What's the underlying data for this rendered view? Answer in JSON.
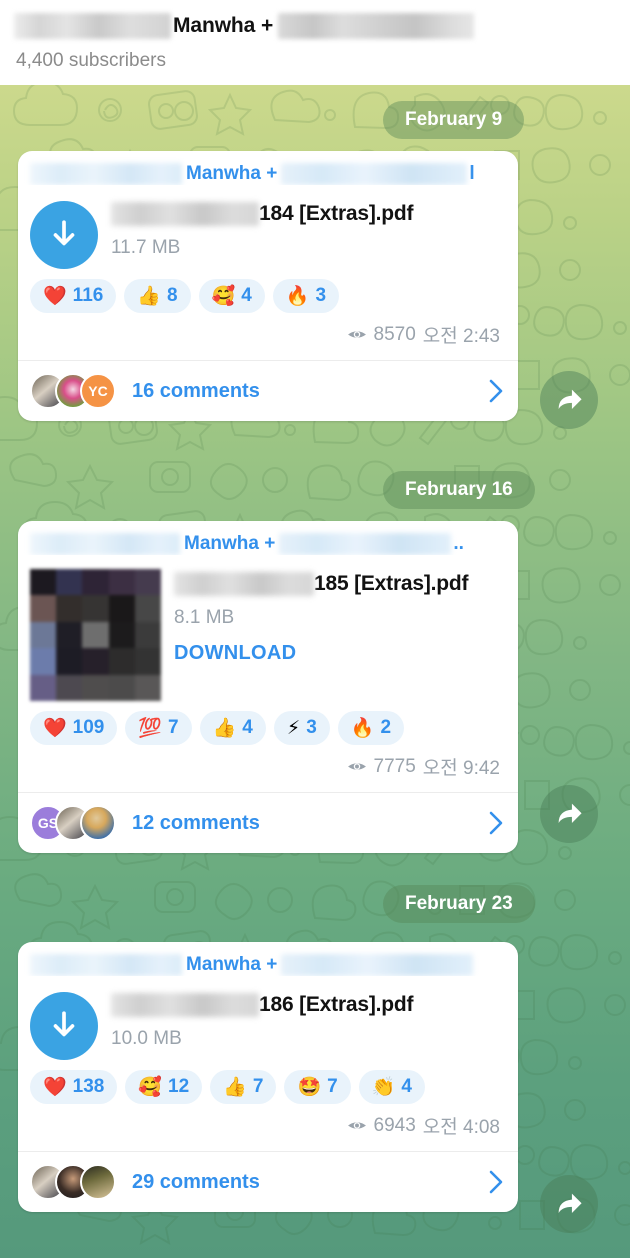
{
  "header": {
    "channel_name": "Manwha +",
    "subscribers": "4,400 subscribers",
    "name_prefix_redacted": true,
    "name_suffix_redacted": true
  },
  "icons": {
    "download_arrow": "download-arrow-icon",
    "eye": "eye-icon",
    "chevron_right": "chevron-right-icon",
    "forward_arrow": "forward-arrow-icon"
  },
  "messages": [
    {
      "date_label": "February 9",
      "forward_label": "Forward",
      "bubble_name": "Manwha +",
      "bubble_name_tail": "l",
      "file_name": "184 [Extras].pdf",
      "file_size": "11.7 MB",
      "download_label": null,
      "has_thumbnail": false,
      "reactions": [
        {
          "emoji": "❤️",
          "name": "heart-reaction",
          "count": "116"
        },
        {
          "emoji": "👍",
          "name": "thumbs-up-reaction",
          "count": "8"
        },
        {
          "emoji": "🥰",
          "name": "smiling-face-with-hearts-reaction",
          "count": "4"
        },
        {
          "emoji": "🔥",
          "name": "fire-reaction",
          "count": "3"
        }
      ],
      "views": "8570",
      "time": "오전 2:43",
      "comments_label": "16 comments",
      "avatars": [
        {
          "type": "photo",
          "colors": [
            "#6b6253",
            "#d8cfc2",
            "#3a3a42"
          ]
        },
        {
          "type": "photo",
          "colors": [
            "#2b1f28",
            "#d94f8a",
            "#6ea03c"
          ]
        },
        {
          "type": "initials",
          "initials": "YC",
          "color": "#f59345"
        }
      ]
    },
    {
      "date_label": "February 16",
      "forward_label": "Forward",
      "bubble_name": "Manwha +",
      "bubble_name_tail": "..",
      "file_name": "185 [Extras].pdf",
      "file_size": "8.1 MB",
      "download_label": "DOWNLOAD",
      "has_thumbnail": true,
      "thumbnail_pixels": [
        "#1c1920",
        "#333350",
        "#2e2436",
        "#3c2f43",
        "#453b4e",
        "#6b5553",
        "#332e2c",
        "#363433",
        "#1a1819",
        "#474747",
        "#6c7897",
        "#1f1e26",
        "#6e6e6e",
        "#1c1b1c",
        "#3b3b3b",
        "#6c7cab",
        "#1d1c25",
        "#26202a",
        "#2d2c2c",
        "#333333",
        "#665e86",
        "#4d4950",
        "#4f4d4d",
        "#4c4b4b",
        "#595757"
      ],
      "reactions": [
        {
          "emoji": "❤️",
          "name": "heart-reaction",
          "count": "109"
        },
        {
          "emoji": "💯",
          "name": "hundred-points-reaction",
          "count": "7"
        },
        {
          "emoji": "👍",
          "name": "thumbs-up-reaction",
          "count": "4"
        },
        {
          "emoji": "⚡",
          "name": "lightning-reaction",
          "count": "3"
        },
        {
          "emoji": "🔥",
          "name": "fire-reaction",
          "count": "2"
        }
      ],
      "views": "7775",
      "time": "오전 9:42",
      "comments_label": "12 comments",
      "avatars": [
        {
          "type": "initials",
          "initials": "GS",
          "color": "#9b7ddb"
        },
        {
          "type": "photo",
          "colors": [
            "#6b6253",
            "#d8cfc2",
            "#3a3a42"
          ]
        },
        {
          "type": "photo",
          "colors": [
            "#2f6ab0",
            "#e0c89a",
            "#d7a85c"
          ]
        }
      ]
    },
    {
      "date_label": "February 23",
      "forward_label": "Forward",
      "bubble_name": "Manwha +",
      "bubble_name_tail": "",
      "file_name": "186 [Extras].pdf",
      "file_size": "10.0 MB",
      "download_label": null,
      "has_thumbnail": false,
      "reactions": [
        {
          "emoji": "❤️",
          "name": "heart-reaction",
          "count": "138"
        },
        {
          "emoji": "🥰",
          "name": "smiling-face-with-hearts-reaction",
          "count": "12"
        },
        {
          "emoji": "👍",
          "name": "thumbs-up-reaction",
          "count": "7"
        },
        {
          "emoji": "🤩",
          "name": "star-struck-reaction",
          "count": "7"
        },
        {
          "emoji": "👏",
          "name": "clapping-hands-reaction",
          "count": "4"
        }
      ],
      "views": "6943",
      "time": "오전 4:08",
      "comments_label": "29 comments",
      "avatars": [
        {
          "type": "photo",
          "colors": [
            "#6b6253",
            "#d8cfc2",
            "#3a3a42"
          ]
        },
        {
          "type": "photo",
          "colors": [
            "#3b2d26",
            "#c69a79",
            "#1b1b1d"
          ]
        },
        {
          "type": "photo",
          "colors": [
            "#6d6a3c",
            "#d8c49a",
            "#2a2a20"
          ]
        }
      ]
    }
  ],
  "colors": {
    "accent_blue": "#3390ec",
    "download_button": "#3aa3e3",
    "reaction_bg": "#e9f3fb",
    "meta_gray": "#9aa3ac",
    "bg_top": "#ccd98c",
    "bg_bottom": "#55997c"
  }
}
